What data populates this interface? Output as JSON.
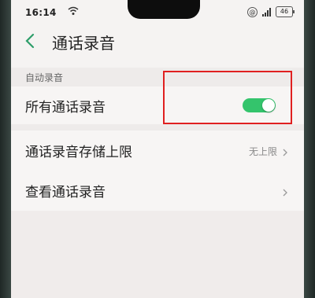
{
  "status_bar": {
    "time": "16:14",
    "battery": "46"
  },
  "header": {
    "title": "通话录音"
  },
  "section": {
    "label": "自动录音"
  },
  "rows": {
    "all_calls": {
      "label": "所有通话录音",
      "enabled": true
    },
    "storage_limit": {
      "label": "通话录音存储上限",
      "value": "无上限"
    },
    "view_recordings": {
      "label": "查看通话录音"
    }
  },
  "colors": {
    "toggle_on": "#34c46c",
    "highlight": "#e02020"
  },
  "icons": [
    "back-arrow-icon",
    "wifi-icon",
    "signal-icon",
    "battery-icon",
    "chevron-right-icon"
  ]
}
